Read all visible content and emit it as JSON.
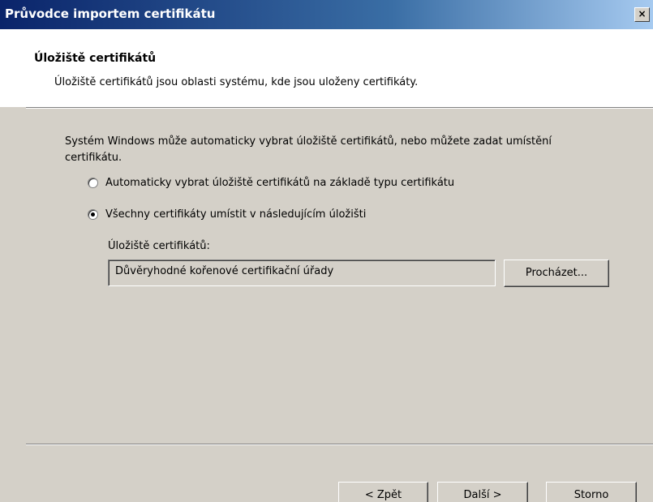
{
  "window": {
    "title": "Průvodce importem certifikátu",
    "close_label": "×"
  },
  "header": {
    "title": "Úložiště certifikátů",
    "subtitle": "Úložiště certifikátů jsou oblasti systému, kde jsou uloženy certifikáty."
  },
  "main": {
    "intro": "Systém Windows může automaticky vybrat úložiště certifikátů, nebo můžete zadat umístění certifikátu.",
    "options": [
      {
        "label": "Automaticky vybrat úložiště certifikátů na základě typu certifikátu",
        "selected": false
      },
      {
        "label": "Všechny certifikáty umístit v následujícím úložišti",
        "selected": true
      }
    ],
    "store_label": "Úložiště certifikátů:",
    "store_value": "Důvěryhodné kořenové certifikační úřady",
    "browse_label": "Procházet..."
  },
  "footer": {
    "back_label": "< Zpět",
    "next_label": "Další >",
    "cancel_label": "Storno"
  },
  "colors": {
    "titlebar_start": "#0a246a",
    "titlebar_end": "#a6caf0",
    "dialog_face": "#d4d0c8",
    "header_bg": "#ffffff"
  }
}
